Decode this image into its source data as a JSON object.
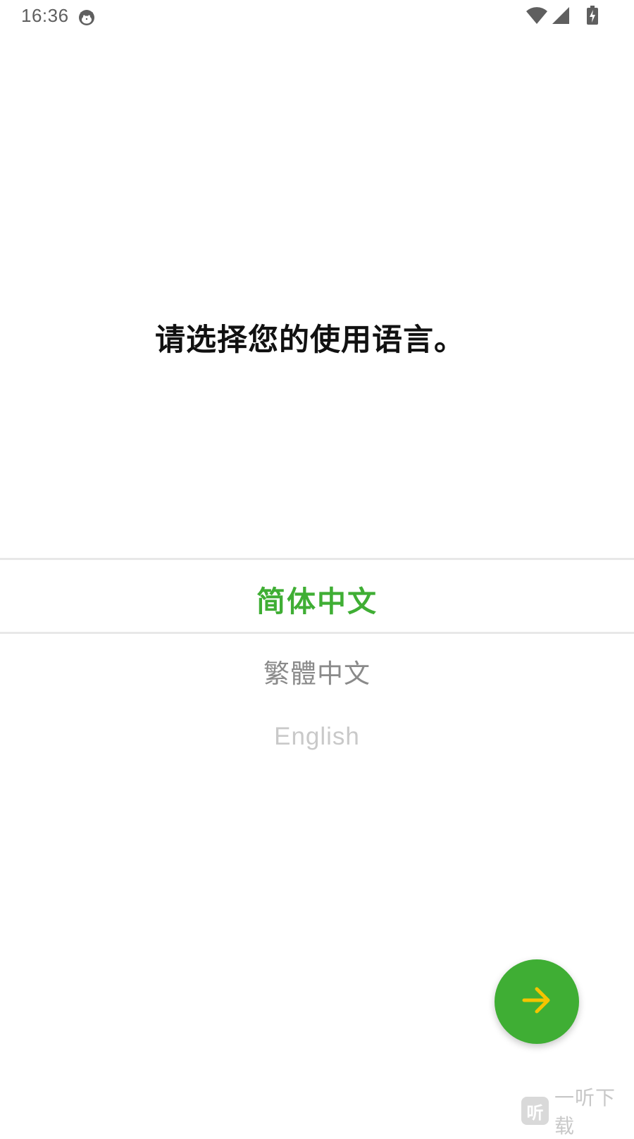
{
  "status_bar": {
    "time": "16:36",
    "app_icon": "cat-face-icon",
    "wifi_icon": "wifi-icon",
    "signal_icon": "cellular-signal-icon",
    "battery_icon": "battery-charging-icon"
  },
  "title": "请选择您的使用语言。",
  "languages": [
    {
      "label": "简体中文",
      "selected": true
    },
    {
      "label": "繁體中文",
      "selected": false
    },
    {
      "label": "English",
      "selected": false
    }
  ],
  "next_button": {
    "icon": "arrow-right-icon",
    "color": "#3fae34",
    "icon_color": "#f5c400"
  },
  "watermark": {
    "logo": "听",
    "text": "一听下载"
  },
  "colors": {
    "accent": "#3fae34",
    "divider": "#e8e8e8"
  }
}
